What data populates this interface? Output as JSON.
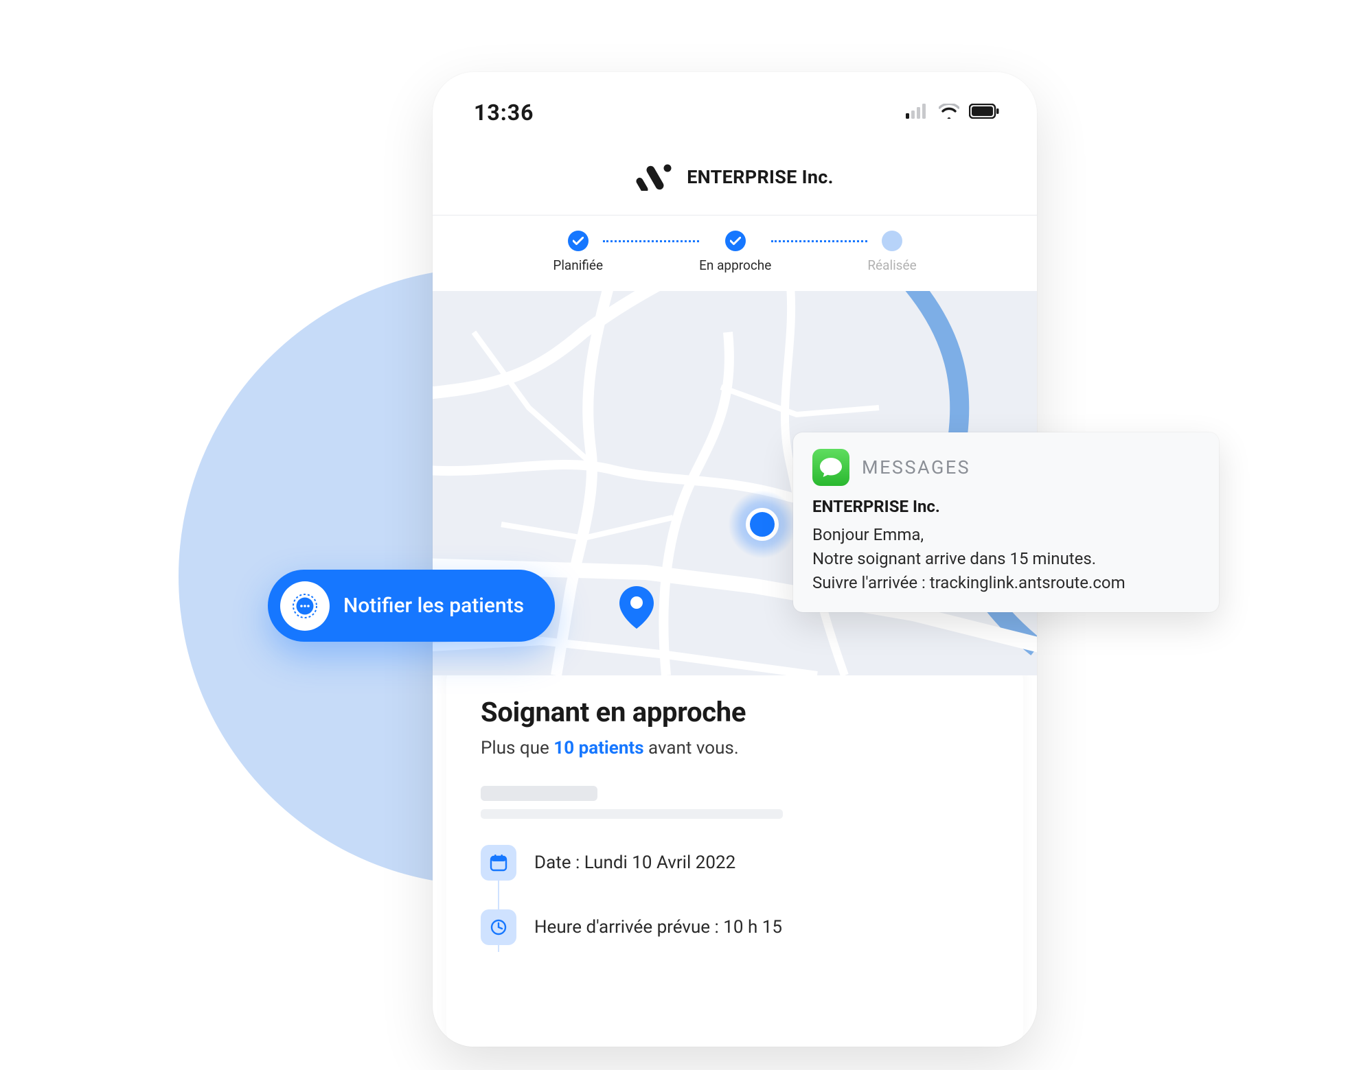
{
  "statusbar": {
    "time": "13:36"
  },
  "header": {
    "company": "ENTERPRISE Inc."
  },
  "progress": {
    "steps": [
      {
        "label": "Planifiée"
      },
      {
        "label": "En approche"
      },
      {
        "label": "Réalisée"
      }
    ]
  },
  "card": {
    "title": "Soignant en approche",
    "sub_before": "Plus que ",
    "sub_highlight": "10 patients",
    "sub_after": " avant vous.",
    "date_row": "Date : Lundi 10 Avril 2022",
    "eta_row": "Heure d'arrivée prévue : 10 h 15"
  },
  "notify": {
    "label": "Notifier les patients"
  },
  "notif": {
    "app_name": "MESSAGES",
    "title": "ENTERPRISE Inc.",
    "line1": "Bonjour Emma,",
    "line2": "Notre soignant arrive dans 15 minutes.",
    "line3": "Suivre l'arrivée : trackinglink.antsroute.com"
  },
  "colors": {
    "accent": "#1677ff"
  }
}
